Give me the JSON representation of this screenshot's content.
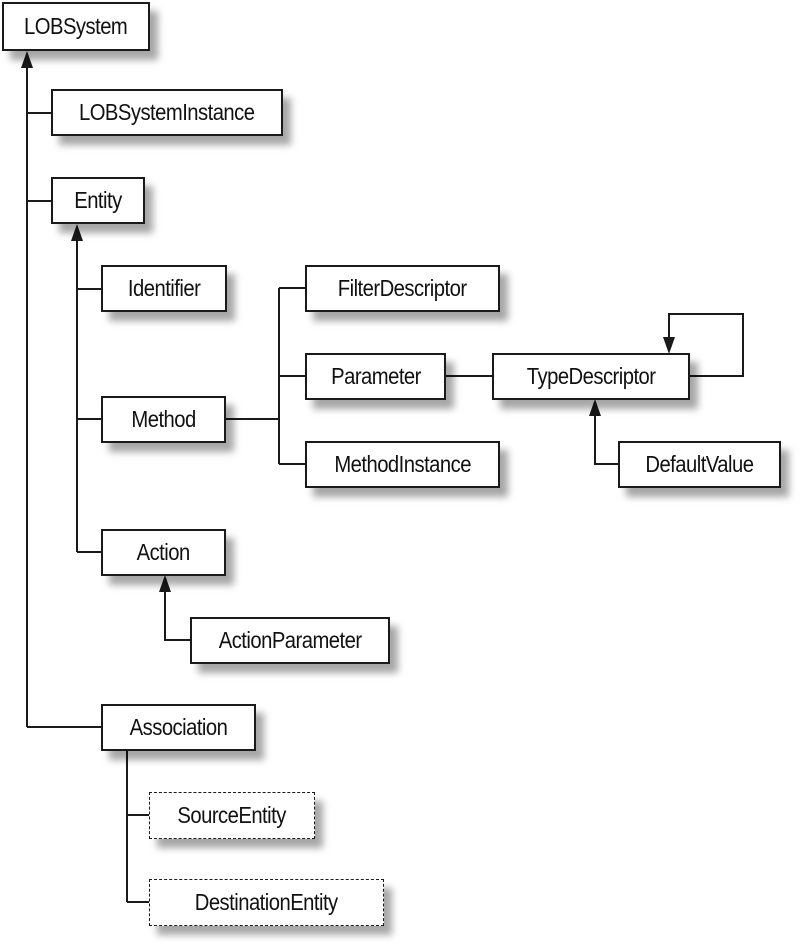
{
  "nodes": {
    "lobsystem": "LOBSystem",
    "lobsysteminstance": "LOBSystemInstance",
    "entity": "Entity",
    "identifier": "Identifier",
    "method": "Method",
    "filterdescriptor": "FilterDescriptor",
    "parameter": "Parameter",
    "typedescriptor": "TypeDescriptor",
    "methodinstance": "MethodInstance",
    "defaultvalue": "DefaultValue",
    "action": "Action",
    "actionparameter": "ActionParameter",
    "association": "Association",
    "sourceentity": "SourceEntity",
    "destinationentity": "DestinationEntity"
  },
  "colors": {
    "line": "#1a1a1a",
    "box_fill": "#ffffff"
  }
}
